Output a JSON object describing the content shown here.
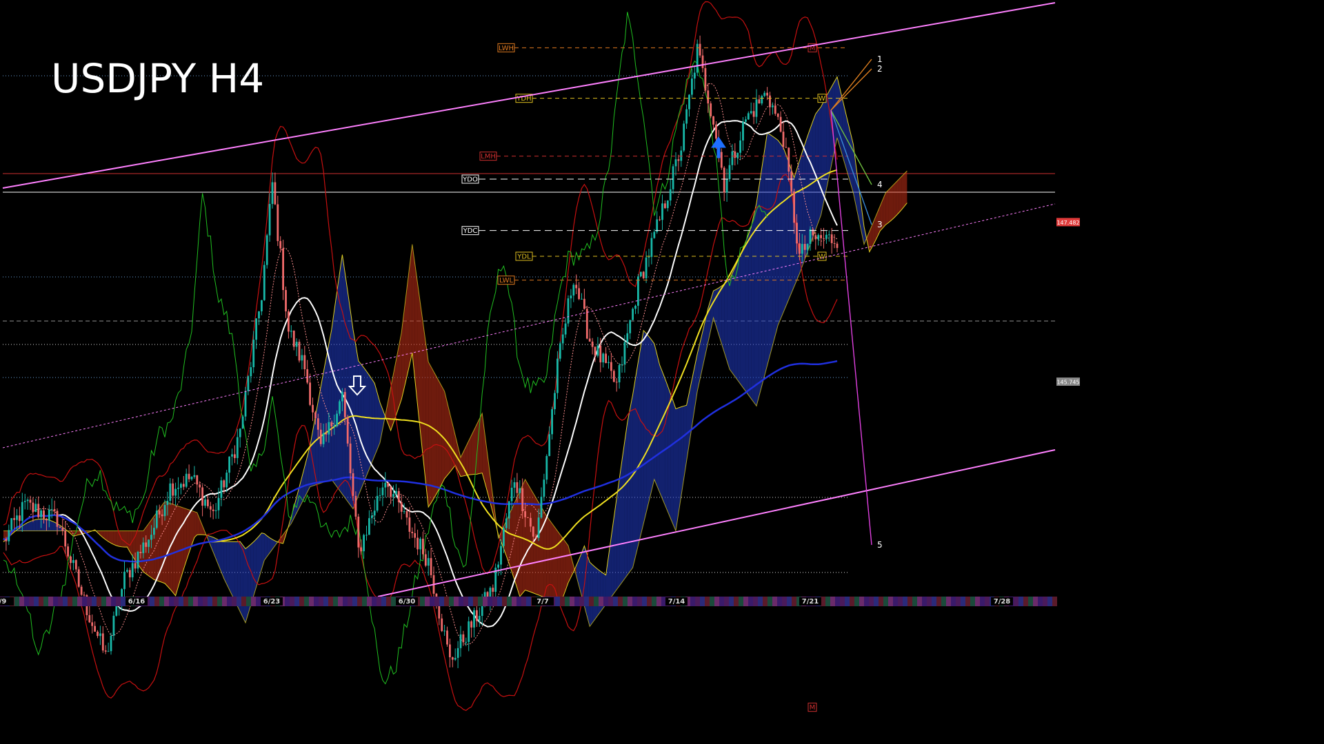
{
  "chart_data": {
    "type": "candlestick",
    "title": "USDJPY H4",
    "symbol": "USDJPY",
    "timeframe": "H4",
    "background": "#000000",
    "x_ticks": [
      "/9",
      "6/16",
      "6/23",
      "6/30",
      "7/7",
      "7/14",
      "7/21",
      "7/28"
    ],
    "ylim": [
      142.1,
      149.75
    ],
    "price_labels": [
      {
        "name": "price-label-147482",
        "text": "147.482",
        "value": 147.482,
        "color": "#e03a3a"
      },
      {
        "name": "price-label-145745",
        "text": "145.745",
        "value": 145.745,
        "color": "#888888"
      }
    ],
    "levels": [
      {
        "name": "level-lwh",
        "text": "LWH",
        "value": 149.38,
        "color": "#e07a20"
      },
      {
        "name": "level-ydh",
        "text": "YDH",
        "value": 148.83,
        "color": "#e0c020"
      },
      {
        "name": "level-lmh",
        "text": "LMH",
        "value": 148.2,
        "color": "#d03030"
      },
      {
        "name": "level-ydo",
        "text": "YDO",
        "value": 147.95,
        "color": "#ffffff"
      },
      {
        "name": "level-ydc",
        "text": "YDC",
        "value": 147.39,
        "color": "#ffffff"
      },
      {
        "name": "level-ydl",
        "text": "YDL",
        "value": 147.11,
        "color": "#e0c020"
      },
      {
        "name": "level-lwl",
        "text": "LWL",
        "value": 146.85,
        "color": "#e07a20"
      }
    ],
    "markers": [
      {
        "name": "marker-w-upper",
        "text": "W",
        "value": 148.83,
        "color": "#e0c020"
      },
      {
        "name": "marker-w-lower",
        "text": "W",
        "value": 147.11,
        "color": "#e0c020"
      },
      {
        "name": "marker-m-upper",
        "text": "M",
        "value": 149.38,
        "color": "#d03030"
      },
      {
        "name": "marker-m-lower",
        "text": "M",
        "value": 142.2,
        "color": "#d03030"
      }
    ],
    "wave_labels": [
      "1",
      "2",
      "3",
      "4",
      "5"
    ],
    "signals": [
      {
        "name": "sell-arrow",
        "type": "down-arrow",
        "color": "#ffffff"
      },
      {
        "name": "buy-arrow",
        "type": "up-arrow",
        "color": "#1e6fff"
      }
    ],
    "colors": {
      "bull": "#18b8a8",
      "bear": "#f06a6a",
      "sma_white": "#ffffff",
      "sma_yellow": "#f0e020",
      "sma_blue": "#2030e0",
      "channel": "#ff80ff",
      "bollinger": "#c81010",
      "kumo_bull": "#203cc8",
      "kumo_bear": "#c83218",
      "chikou": "#20c020",
      "cloud_edge": "#e0d020"
    }
  }
}
